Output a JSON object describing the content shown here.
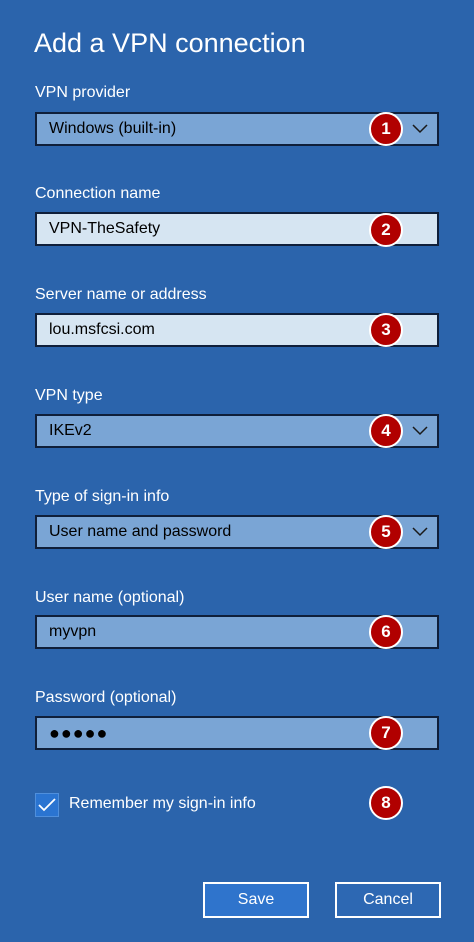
{
  "title": "Add a VPN connection",
  "fields": {
    "provider": {
      "label": "VPN provider",
      "value": "Windows (built-in)",
      "badge": "1"
    },
    "connection_name": {
      "label": "Connection name",
      "value": "VPN-TheSafety",
      "badge": "2"
    },
    "server": {
      "label": "Server name or address",
      "value": "lou.msfcsi.com",
      "badge": "3"
    },
    "vpn_type": {
      "label": "VPN type",
      "value": "IKEv2",
      "badge": "4"
    },
    "signin_type": {
      "label": "Type of sign-in info",
      "value": "User name and password",
      "badge": "5"
    },
    "username": {
      "label": "User name (optional)",
      "value": "myvpn",
      "badge": "6"
    },
    "password": {
      "label": "Password (optional)",
      "value": "●●●●●",
      "badge": "7"
    }
  },
  "remember": {
    "label": "Remember my sign-in info",
    "checked": true,
    "badge": "8"
  },
  "buttons": {
    "save": "Save",
    "cancel": "Cancel"
  },
  "colors": {
    "background": "#2b64ac",
    "badge": "#b10000",
    "field_select": "#7aa5d5",
    "field_text": "#d6e5f2"
  }
}
